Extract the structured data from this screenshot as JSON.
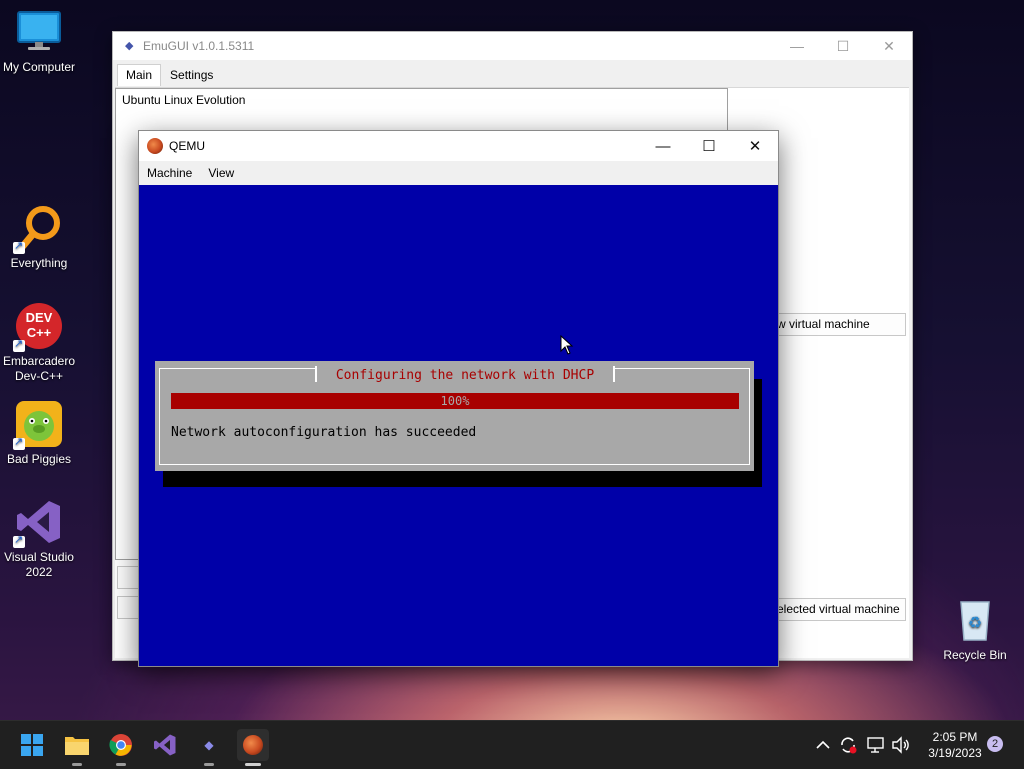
{
  "desktop": {
    "icons": [
      {
        "label": "My Computer"
      },
      {
        "label": "Everything"
      },
      {
        "label": "Embarcadero Dev-C++"
      },
      {
        "label": "Bad Piggies"
      },
      {
        "label": "Visual Studio 2022"
      },
      {
        "label": "Recycle Bin"
      }
    ],
    "devcpp_icon_text": "DEV C++"
  },
  "emugui": {
    "title": "EmuGUI v1.0.1.5311",
    "tabs": [
      {
        "label": "Main"
      },
      {
        "label": "Settings"
      }
    ],
    "vm_list": [
      "Ubuntu Linux Evolution"
    ],
    "buttons": {
      "new_vm": "w virtual machine",
      "delete_vm": "elected virtual machine"
    },
    "caption": {
      "minimize": "—",
      "maximize": "☐",
      "close": "✕"
    }
  },
  "qemu": {
    "title": "QEMU",
    "menu": [
      "Machine",
      "View"
    ],
    "caption": {
      "minimize": "—",
      "maximize": "☐",
      "close": "✕"
    },
    "dialog": {
      "title": "Configuring the network with DHCP",
      "progress_text": "100%",
      "progress": 100,
      "message": "Network autoconfiguration has succeeded"
    }
  },
  "taskbar": {
    "apps": [
      "start-icon",
      "file-explorer-icon",
      "chrome-icon",
      "visual-studio-icon",
      "emugui-icon",
      "qemu-icon"
    ],
    "clock": {
      "time": "2:05 PM",
      "date": "3/19/2023"
    },
    "notifications": "2"
  },
  "colors": {
    "qemu_screen": "#0000a8",
    "dialog_bg": "#a8a8a8",
    "dialog_title": "#a80000",
    "progress_bar": "#a80000"
  }
}
